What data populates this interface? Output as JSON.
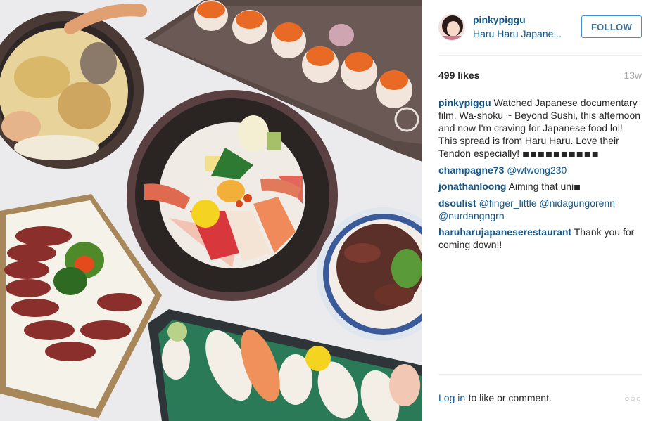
{
  "post": {
    "username": "pinkypiggu",
    "location": "Haru Haru Japane...",
    "follow_label": "FOLLOW",
    "likes": "499 likes",
    "age": "13w",
    "caption": {
      "author": "pinkypiggu",
      "text": "Watched Japanese documentary film, Wa-shoku ~ Beyond Sushi, this afternoon and now I'm craving for Japanese food lol! This spread is from Haru Haru. Love their Tendon especially!",
      "trailing_glyphs": "◼◼◼◼◼◼◼◼◼◼"
    },
    "comments": [
      {
        "author": "champagne73",
        "mention": "@wtwong230",
        "text": ""
      },
      {
        "author": "jonathanloong",
        "text": "Aiming that uni",
        "trailing_glyph": "◼"
      },
      {
        "author": "dsoulist",
        "mention": "@finger_little @nidagungorenn @nurdangngrn",
        "text": ""
      },
      {
        "author": "haruharujapaneserestaurant",
        "text": "Thank you for coming down!!"
      }
    ],
    "footer": {
      "login_link": "Log in",
      "login_rest": "to like or comment.",
      "more_icon": "ellipsis-icon"
    }
  },
  "colors": {
    "link": "#125688",
    "follow_border": "#4090db",
    "muted": "#a5a7aa"
  }
}
